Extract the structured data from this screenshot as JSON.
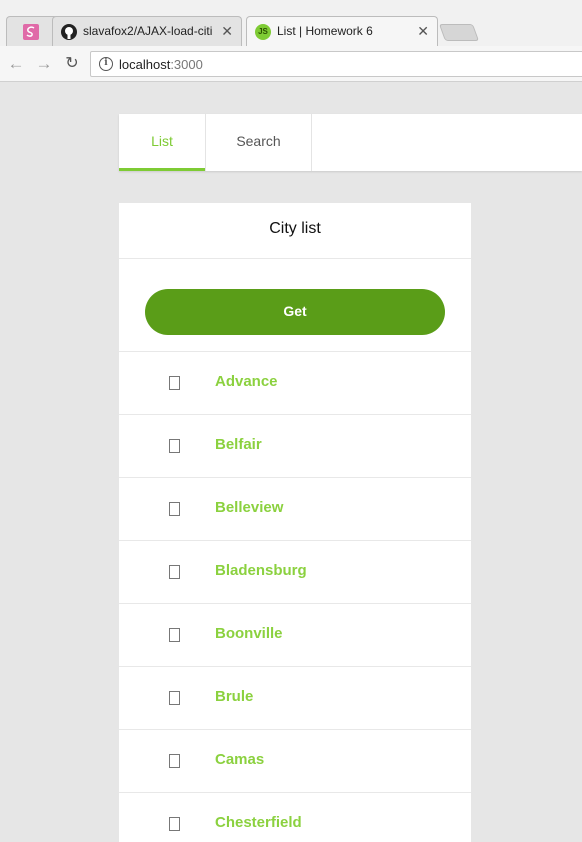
{
  "browser": {
    "tabs": [
      {
        "title": "",
        "favicon": "sass-icon"
      },
      {
        "title": "slavafox2/AJAX-load-citi",
        "favicon": "github-icon"
      },
      {
        "title": "List | Homework 6",
        "favicon": "js-icon",
        "favicon_text": "JS"
      }
    ],
    "close_glyph": "✕",
    "address": {
      "host": "localhost",
      "port": ":3000"
    },
    "info_glyph": "i",
    "back_glyph": "←",
    "forward_glyph": "→",
    "reload_glyph": "↻"
  },
  "nav": {
    "tabs": [
      {
        "label": "List",
        "active": true
      },
      {
        "label": "Search",
        "active": false
      }
    ]
  },
  "card": {
    "title": "City list",
    "button_label": "Get",
    "cities": [
      {
        "name": "Advance",
        "checked": false
      },
      {
        "name": "Belfair",
        "checked": false
      },
      {
        "name": "Belleview",
        "checked": false
      },
      {
        "name": "Bladensburg",
        "checked": false
      },
      {
        "name": "Boonville",
        "checked": false
      },
      {
        "name": "Brule",
        "checked": false
      },
      {
        "name": "Camas",
        "checked": false
      },
      {
        "name": "Chesterfield",
        "checked": false
      }
    ]
  },
  "colors": {
    "accent": "#7ecb34",
    "button": "#5a9d18",
    "city_text": "#8bd13f",
    "background": "#e6e6e6"
  }
}
